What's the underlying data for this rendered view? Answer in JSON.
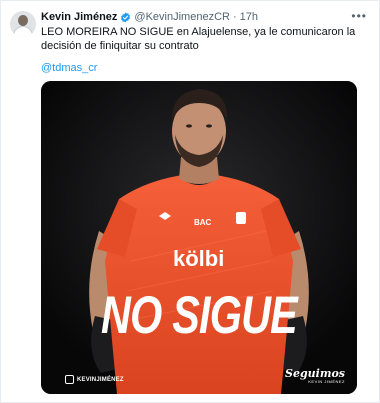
{
  "tweet": {
    "author_name": "Kevin Jiménez",
    "handle": "@KevinJimenezCR",
    "separator": "·",
    "time": "17h",
    "more_icon": "ellipsis-icon",
    "verified_icon": "verified-badge-icon",
    "text": "LEO MOREIRA NO SIGUE en Alajuelense, ya le comunicaron la decisión de finiquitar su contrato",
    "mention": "@tdmas_cr",
    "colors": {
      "link": "#1d9bf0",
      "verified": "#1d9bf0",
      "jersey": "#f2552e",
      "media_bg": "#0b0b0c"
    }
  },
  "media": {
    "headline": "NO SIGUE",
    "jersey_brand": "BAC",
    "jersey_sponsor": "kölbi",
    "footer_left": "KEVINJIMÉNEZ",
    "footer_right_script": "Seguimos",
    "footer_right_small": "KEVIN JIMÉNEZ"
  }
}
